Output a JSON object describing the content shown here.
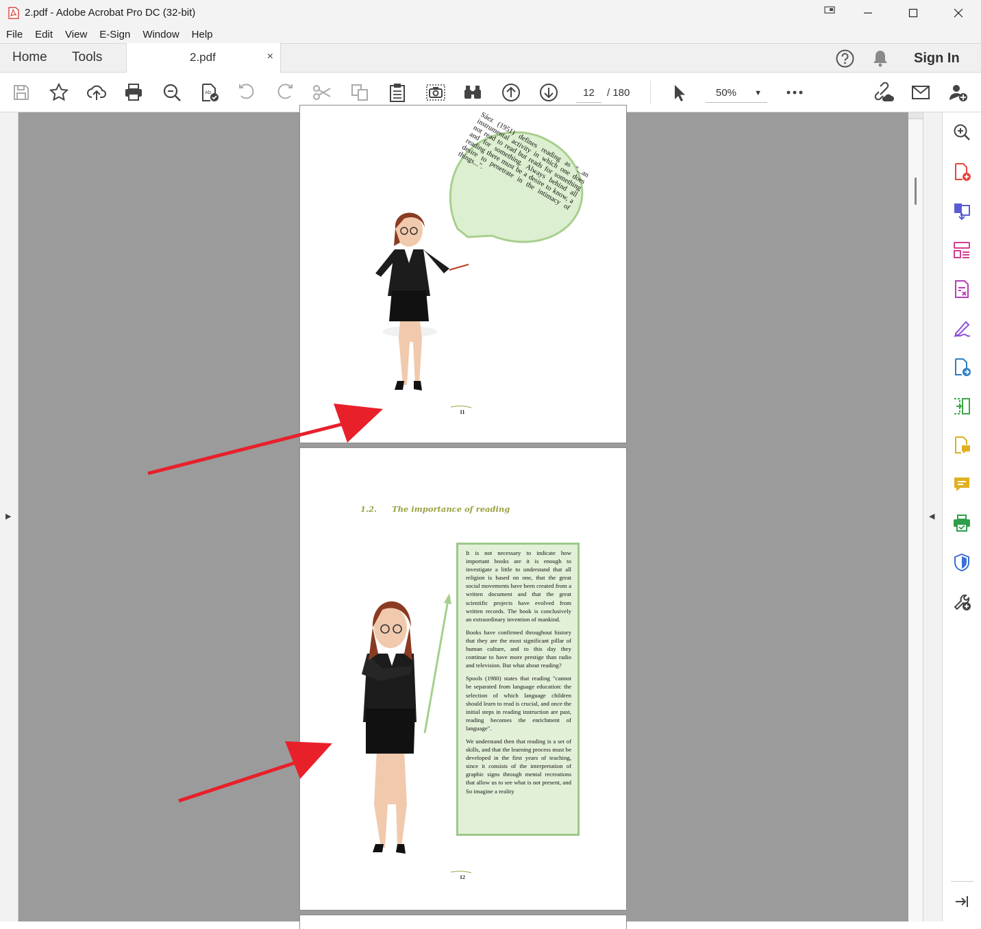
{
  "window": {
    "title": "2.pdf - Adobe Acrobat Pro DC (32-bit)"
  },
  "menu": [
    "File",
    "Edit",
    "View",
    "E-Sign",
    "Window",
    "Help"
  ],
  "tabs": {
    "home": "Home",
    "tools": "Tools",
    "document": "2.pdf",
    "close": "×",
    "sign_in": "Sign In"
  },
  "toolbar": {
    "current_page": "12",
    "total_pages": "/  180",
    "zoom": "50%"
  },
  "pages": {
    "page11": {
      "bubble_text": "Sáez (1951) defines reading as \"...an instrumental activity in which one does not read to read but reads for something and for something. Always behind all reading there must be a desire to know, a desire to penetrate in the intimacy of things...\".",
      "page_number": "11"
    },
    "page12": {
      "heading_number": "1.2.",
      "heading_title": "The importance of reading",
      "paragraphs": [
        "It is not necessary to indicate how important books are it is enough to investigate a little to understand that all religion is based on one, that the great social movements have been created from a written document and that the great scientific projects have evolved from written records. The book is conclusively an extraordinary invention of mankind.",
        "Books have confirmed throughout history that they are the most significant pillar of human culture, and to this day they continue to have more prestige than radio and television. But what about reading?",
        "Spools (1980) states that reading \"cannot be separated from language education: the selection of which language children should learn to read is crucial, and once the initial steps in reading instruction are past, reading becomes the enrichment of language\".",
        "We understand then that reading is a set of skills, and that the learning process must be developed in the first years of teaching, since it consists of the interpretation of graphic signs through mental recreations that allow us to see what is not present, and So imagine a reality"
      ],
      "page_number": "12"
    }
  },
  "colors": {
    "accent_red": "#e8202a",
    "bubble_green": "#dcefd0",
    "heading_olive": "#9aa241"
  }
}
